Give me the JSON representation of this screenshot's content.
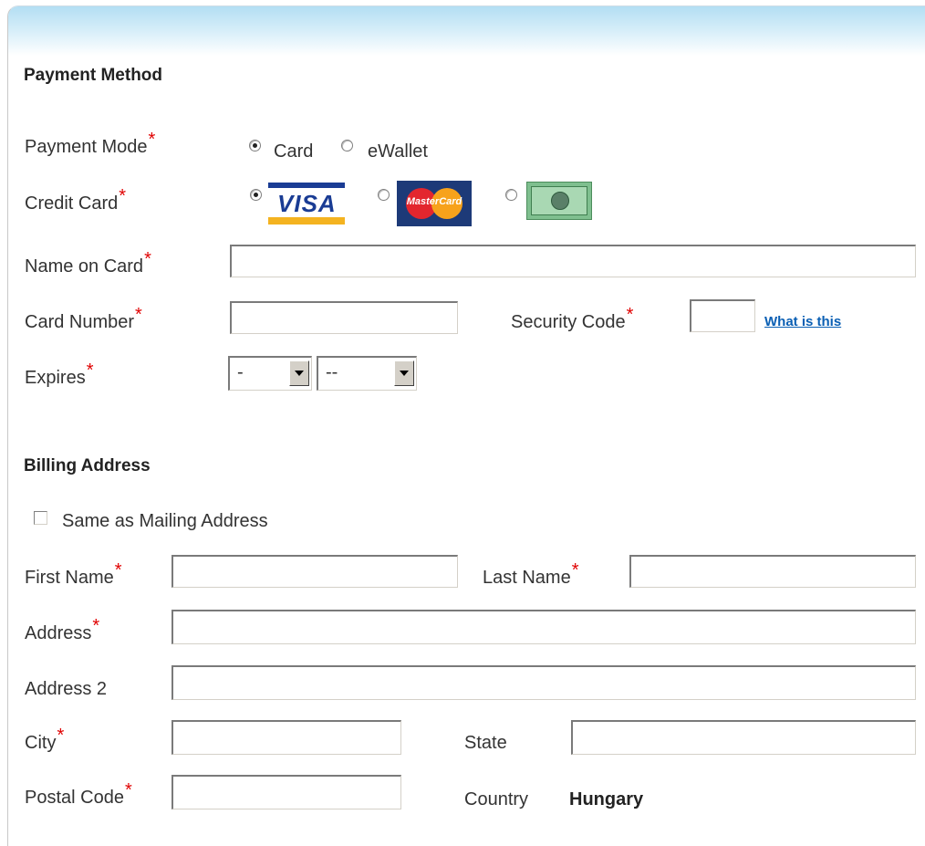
{
  "payment_method": {
    "heading": "Payment Method",
    "payment_mode": {
      "label": "Payment Mode",
      "options": [
        {
          "label": "Card",
          "selected": true
        },
        {
          "label": "eWallet",
          "selected": false
        }
      ]
    },
    "credit_card": {
      "label": "Credit Card",
      "options": [
        {
          "name": "visa",
          "text": "VISA",
          "selected": true
        },
        {
          "name": "mastercard",
          "text": "MasterCard",
          "selected": false
        },
        {
          "name": "amex",
          "selected": false
        }
      ]
    },
    "name_on_card": {
      "label": "Name on Card",
      "value": ""
    },
    "card_number": {
      "label": "Card Number",
      "value": ""
    },
    "security_code": {
      "label": "Security Code",
      "value": "",
      "help_link": "What is this"
    },
    "expires": {
      "label": "Expires",
      "month_value": "-",
      "year_value": "--"
    }
  },
  "billing_address": {
    "heading": "Billing Address",
    "same_as_mailing": {
      "label": "Same as Mailing Address",
      "checked": false
    },
    "first_name": {
      "label": "First Name",
      "value": ""
    },
    "last_name": {
      "label": "Last Name",
      "value": ""
    },
    "address": {
      "label": "Address",
      "value": ""
    },
    "address2": {
      "label": "Address 2",
      "value": ""
    },
    "city": {
      "label": "City",
      "value": ""
    },
    "state": {
      "label": "State",
      "value": ""
    },
    "postal_code": {
      "label": "Postal Code",
      "value": ""
    },
    "country": {
      "label": "Country",
      "value": "Hungary"
    }
  },
  "required_marker": "*",
  "colors": {
    "required": "#e00000",
    "link": "#0a5fb4",
    "header_gradient_top": "#b3def3"
  }
}
